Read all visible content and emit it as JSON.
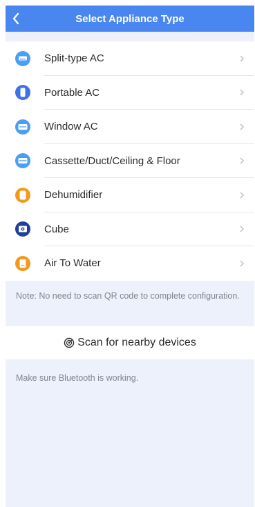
{
  "header": {
    "title": "Select Appliance Type",
    "back_icon": "chevron-left-icon"
  },
  "appliances": [
    {
      "label": "Split-type AC",
      "icon": "split-ac-icon",
      "color": "#4a9ef5"
    },
    {
      "label": "Portable AC",
      "icon": "portable-ac-icon",
      "color": "#3f72e8"
    },
    {
      "label": "Window AC",
      "icon": "window-ac-icon",
      "color": "#4a9ef5"
    },
    {
      "label": "Cassette/Duct/Ceiling & Floor",
      "icon": "cassette-ac-icon",
      "color": "#4a9ef5"
    },
    {
      "label": "Dehumidifier",
      "icon": "dehumidifier-icon",
      "color": "#f39a1e"
    },
    {
      "label": "Cube",
      "icon": "cube-icon",
      "color": "#1f3f9a"
    },
    {
      "label": "Air To Water",
      "icon": "air-to-water-icon",
      "color": "#f39a1e"
    }
  ],
  "note": "Note: No need to scan QR code to complete configuration.",
  "scan": {
    "label": "Scan for nearby devices",
    "icon": "scan-icon"
  },
  "bluetooth_note": "Make sure Bluetooth is working."
}
